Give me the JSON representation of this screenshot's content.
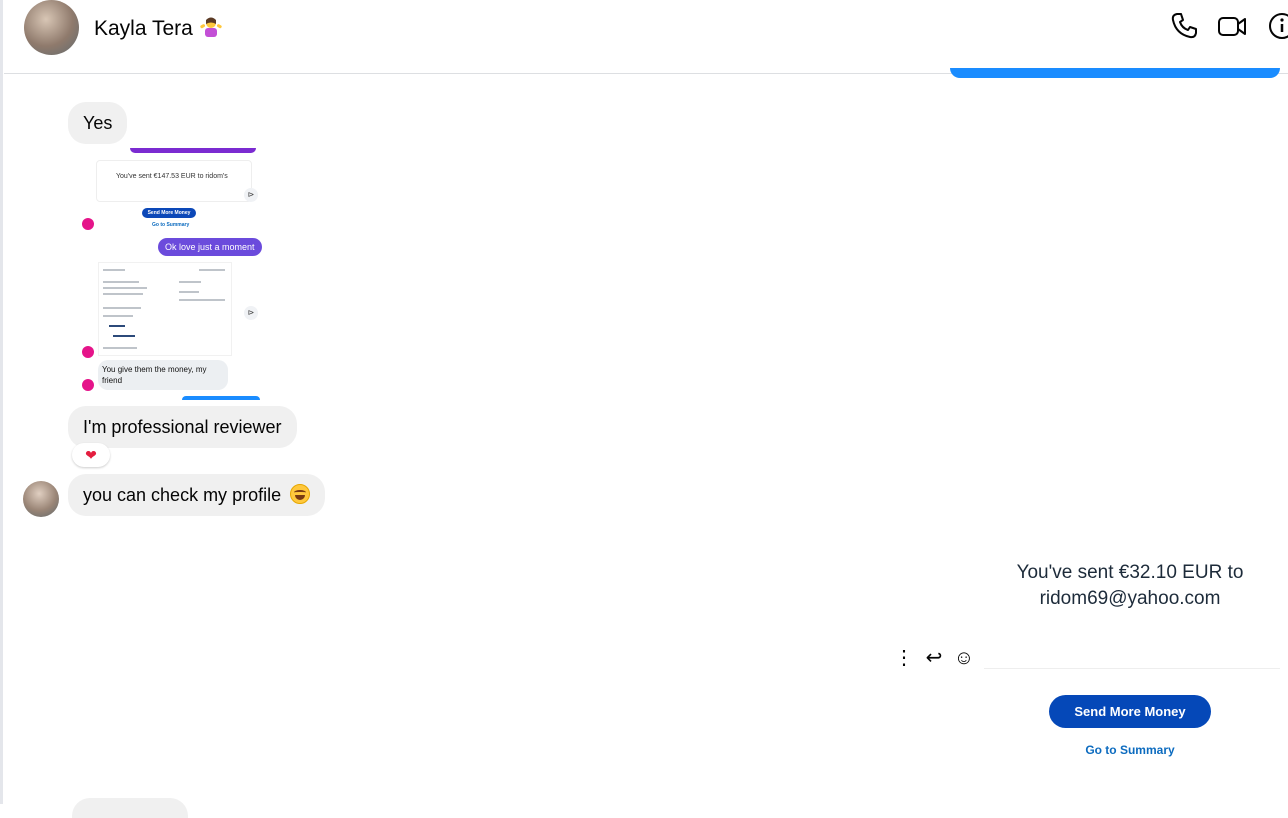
{
  "header": {
    "name": "Kayla Tera",
    "icons": [
      "phone-icon",
      "video-camera-icon",
      "info-icon"
    ]
  },
  "messages": {
    "yes": "Yes",
    "reviewer": "I'm professional reviewer",
    "check_profile": "you can check my profile",
    "reaction": "❤"
  },
  "forwarded_screenshot": {
    "sent_line": "You've sent €147.53 EUR to ridom's",
    "send_more": "Send More Money",
    "go_summary": "Go to Summary",
    "ok_reply": "Ok love just a moment",
    "give_money": "You give them the money, my friend"
  },
  "payment_card": {
    "sent_text": "You've sent €32.10 EUR to ridom69@yahoo.com",
    "send_more_label": "Send More Money",
    "summary_label": "Go to Summary"
  },
  "actions": {
    "more": "⋮",
    "reply": "↩",
    "react": "☺"
  },
  "colors": {
    "sent_bubble": "#1a8cff",
    "received_bubble": "#f0f0f0",
    "paypal_blue": "#0548b8"
  }
}
